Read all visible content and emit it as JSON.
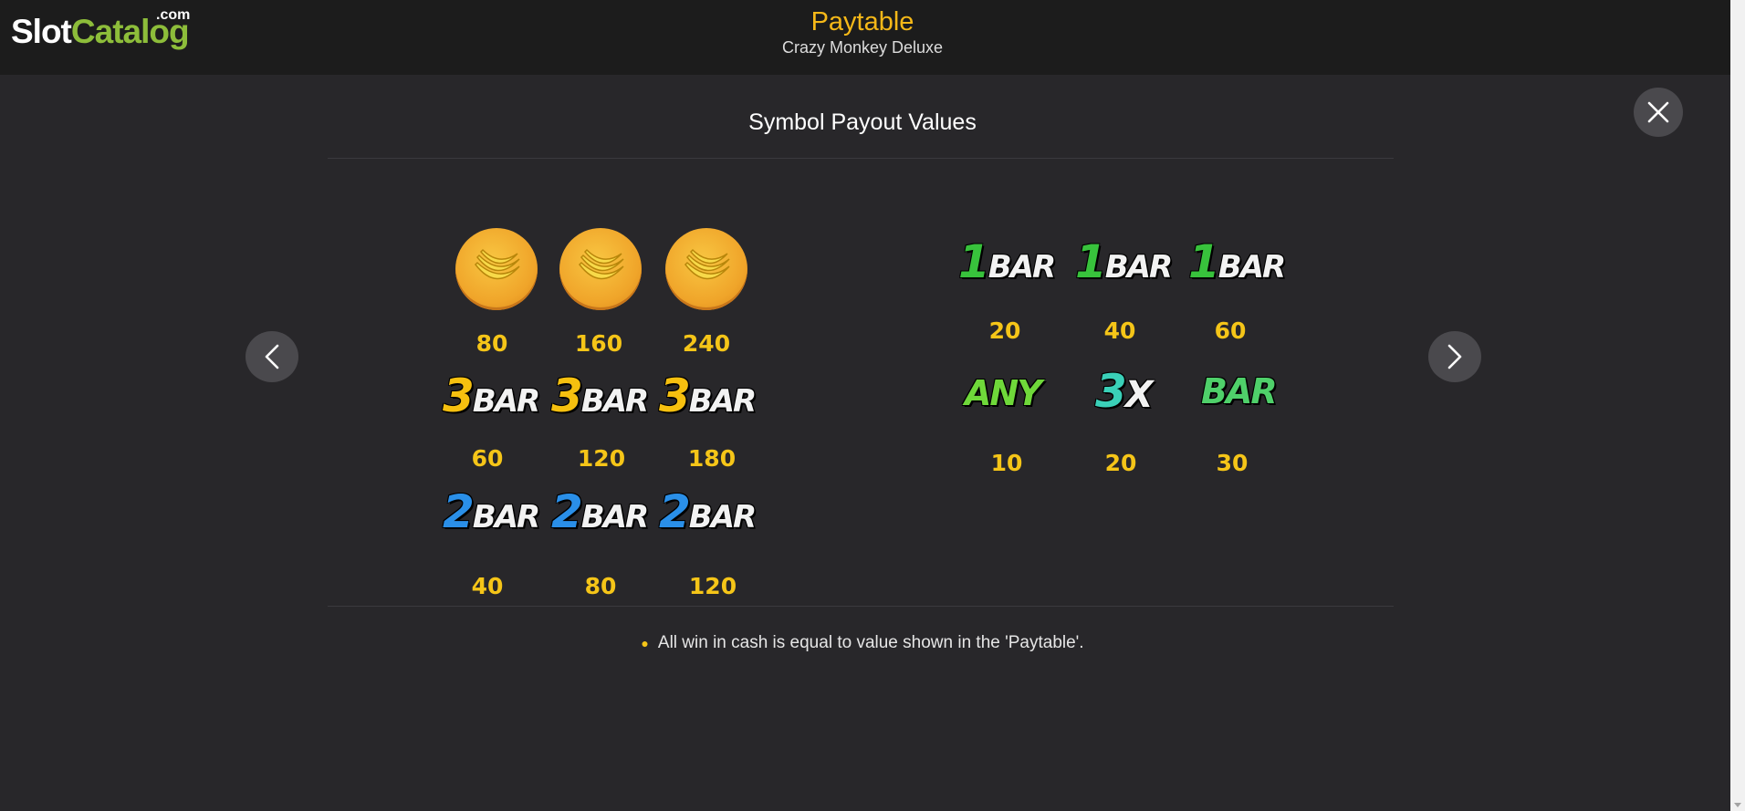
{
  "brand": {
    "logo_slot": "Slot",
    "logo_catalog": "Catalog",
    "logo_dotcom": ".com"
  },
  "header": {
    "title": "Paytable",
    "subtitle": "Crazy Monkey Deluxe"
  },
  "section": {
    "title": "Symbol Payout Values"
  },
  "nav": {
    "prev_label": "<",
    "next_label": ">"
  },
  "left_table": {
    "banana_values": [
      "80",
      "160",
      "240"
    ],
    "bar3_label": {
      "num": "3",
      "word": "BAR"
    },
    "bar3_values": [
      "60",
      "120",
      "180"
    ],
    "bar2_label": {
      "num": "2",
      "word": "BAR"
    },
    "bar2_values": [
      "40",
      "80",
      "120"
    ]
  },
  "right_table": {
    "bar1_label": {
      "num": "1",
      "word": "BAR"
    },
    "bar1_values": [
      "20",
      "40",
      "60"
    ],
    "any_label": "ANY",
    "x3_label": {
      "num": "3",
      "word": "X"
    },
    "bar_label": "BAR",
    "mixed_values": [
      "10",
      "20",
      "30"
    ]
  },
  "note": {
    "text": "All win in cash is equal to value shown in the 'Paytable'."
  },
  "colors": {
    "accent": "#f5b818",
    "value": "#f5c518",
    "background": "#28272a",
    "topbar": "#1c1c1c",
    "logo_green": "#8dbd3a",
    "bar3_yellow": "#f6c00f",
    "bar2_blue": "#2a8fe8",
    "bar1_green": "#38c23c"
  },
  "icons": {
    "close": "close-icon",
    "prev": "chevron-left-icon",
    "next": "chevron-right-icon",
    "banana": "banana-coin-icon"
  }
}
